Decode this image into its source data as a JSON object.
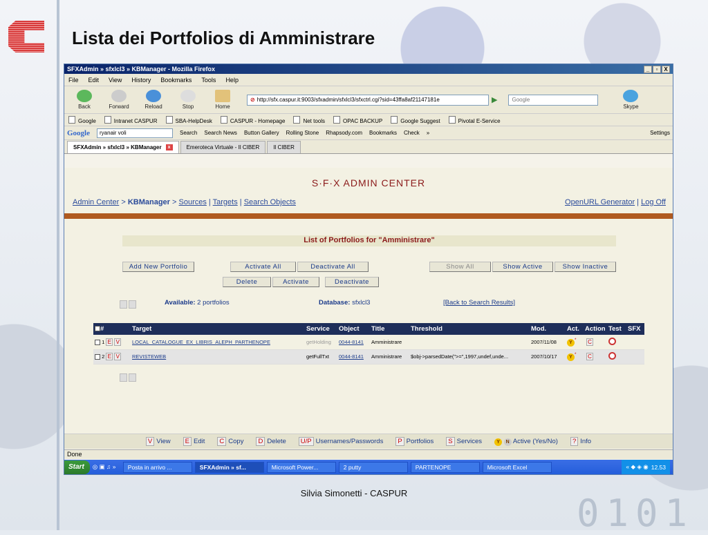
{
  "slide": {
    "title": "Lista dei Portfolios di Amministrare",
    "footer": "Silvia Simonetti - CASPUR",
    "digits": "0101"
  },
  "window": {
    "title": "SFXAdmin » sfxlcl3 » KBManager - Mozilla Firefox",
    "controls": [
      "_",
      "▫",
      "X"
    ]
  },
  "menu": [
    "File",
    "Edit",
    "View",
    "History",
    "Bookmarks",
    "Tools",
    "Help"
  ],
  "nav": {
    "back": "Back",
    "forward": "Forward",
    "reload": "Reload",
    "stop": "Stop",
    "home": "Home",
    "skype": "Skype",
    "url": "http://sfx.caspur.it:9003/sfxadmin/sfxlcl3/sfxctrl.cgi?sid=43ffa8af21147181e",
    "search_placeholder": "Google"
  },
  "bookmarks": [
    "Google",
    "Intranet CASPUR",
    "SBA-HelpDesk",
    "CASPUR - Homepage",
    "Net tools",
    "OPAC BACKUP",
    "Google Suggest",
    "Pivotal E-Service"
  ],
  "googlebar": {
    "logo": "Google",
    "query": "ryanair voli",
    "items": [
      "Search",
      "Search News",
      "Button Gallery",
      "Rolling Stone",
      "Rhapsody.com",
      "Bookmarks",
      "Check",
      "»",
      "Settings"
    ]
  },
  "tabs": [
    {
      "label": "SFXAdmin » sfxlcl3 » KBManager"
    },
    {
      "label": "Emeroteca Virtuale - Il CIBER"
    },
    {
      "label": "Il CIBER"
    }
  ],
  "sfx": {
    "header": "S·F·X ADMIN CENTER",
    "crumb_admin": "Admin Center",
    "crumb_sep": ">",
    "crumb_kb": "KBManager",
    "crumb_sources": "Sources",
    "crumb_targets": "Targets",
    "crumb_search": "Search Objects",
    "openurl": "OpenURL Generator",
    "logoff": "Log Off"
  },
  "list": {
    "title": "List of Portfolios for \"Amministrare\"",
    "btn_add": "Add New Portfolio",
    "btn_activate_all": "Activate All",
    "btn_deactivate_all": "Deactivate All",
    "btn_show_all": "Show All",
    "btn_show_active": "Show Active",
    "btn_show_inactive": "Show Inactive",
    "btn_delete": "Delete",
    "btn_activate": "Activate",
    "btn_deactivate": "Deactivate",
    "available_label": "Available:",
    "available_value": "2 portfolios",
    "database_label": "Database:",
    "database_value": "sfxlcl3",
    "back_link": "[Back to Search Results]"
  },
  "table": {
    "headers": [
      "#",
      "Target",
      "Service",
      "Object",
      "Title",
      "Threshold",
      "Mod.",
      "Act.",
      "Action",
      "Test",
      "SFX"
    ],
    "rows": [
      {
        "num": "1",
        "target": "LOCAL_CATALOGUE_EX_LIBRIS_ALEPH_PARTHENOPE",
        "service": "getHolding",
        "object": "0044-8141",
        "title": "Amministrare",
        "threshold": "",
        "mod": "2007/11/08",
        "act": "Y",
        "star": "*",
        "c": "C"
      },
      {
        "num": "2",
        "target": "REVISTEWEB",
        "service": "getFullTxt",
        "object": "0044-8141",
        "title": "Amministrare",
        "threshold": "$obj->parsedDate(\">=\",1997,undef,unde...",
        "mod": "2007/10/17",
        "act": "Y",
        "star": "*",
        "c": "C"
      }
    ]
  },
  "legend": [
    {
      "k": "V",
      "t": "View"
    },
    {
      "k": "E",
      "t": "Edit"
    },
    {
      "k": "C",
      "t": "Copy"
    },
    {
      "k": "D",
      "t": "Delete"
    },
    {
      "k": "U/P",
      "t": "Usernames/Passwords"
    },
    {
      "k": "P",
      "t": "Portfolios"
    },
    {
      "k": "S",
      "t": "Services"
    },
    {
      "k": "Y",
      "t": ""
    },
    {
      "k": "N",
      "t": "Active (Yes/No)"
    },
    {
      "k": "?",
      "t": "Info"
    }
  ],
  "status": "Done",
  "taskbar": {
    "start": "Start",
    "items": [
      "Posta in arrivo ...",
      "SFXAdmin » sf...",
      "Microsoft Power...",
      "2 putty",
      "PARTENOPE",
      "Microsoft Excel"
    ],
    "clock": "12.53"
  }
}
